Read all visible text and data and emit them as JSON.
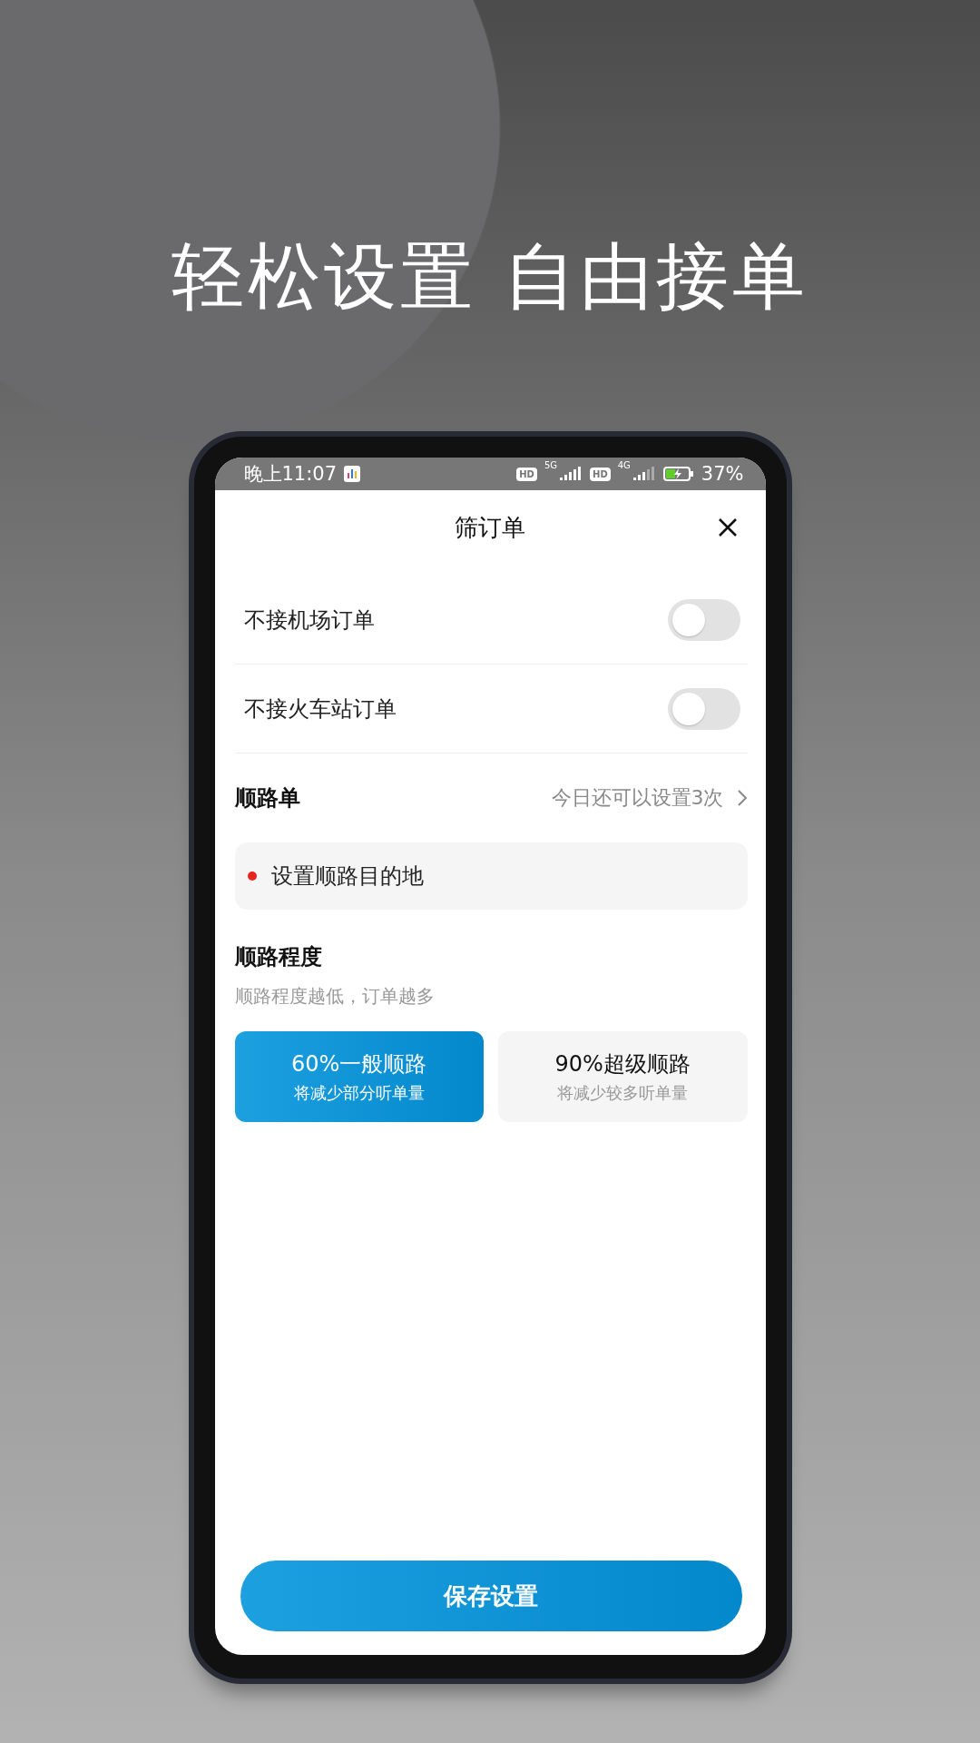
{
  "headline": "轻松设置 自由接单",
  "status_bar": {
    "time": "晚上11:07",
    "sims": [
      {
        "badge": "HD",
        "network": "5G"
      },
      {
        "badge": "HD",
        "network": "4G"
      }
    ],
    "battery": "37%"
  },
  "sheet": {
    "title": "筛订单"
  },
  "filters": [
    {
      "label": "不接机场订单",
      "on": false
    },
    {
      "label": "不接火车站订单",
      "on": false
    }
  ],
  "route_order": {
    "title": "顺路单",
    "hint": "今日还可以设置3次",
    "destination": "设置顺路目的地"
  },
  "route_level": {
    "title": "顺路程度",
    "subtitle": "顺路程度越低，订单越多",
    "options": [
      {
        "title": "60%一般顺路",
        "note": "将减少部分听单量",
        "selected": true
      },
      {
        "title": "90%超级顺路",
        "note": "将减少较多听单量",
        "selected": false
      }
    ]
  },
  "save_button": "保存设置"
}
